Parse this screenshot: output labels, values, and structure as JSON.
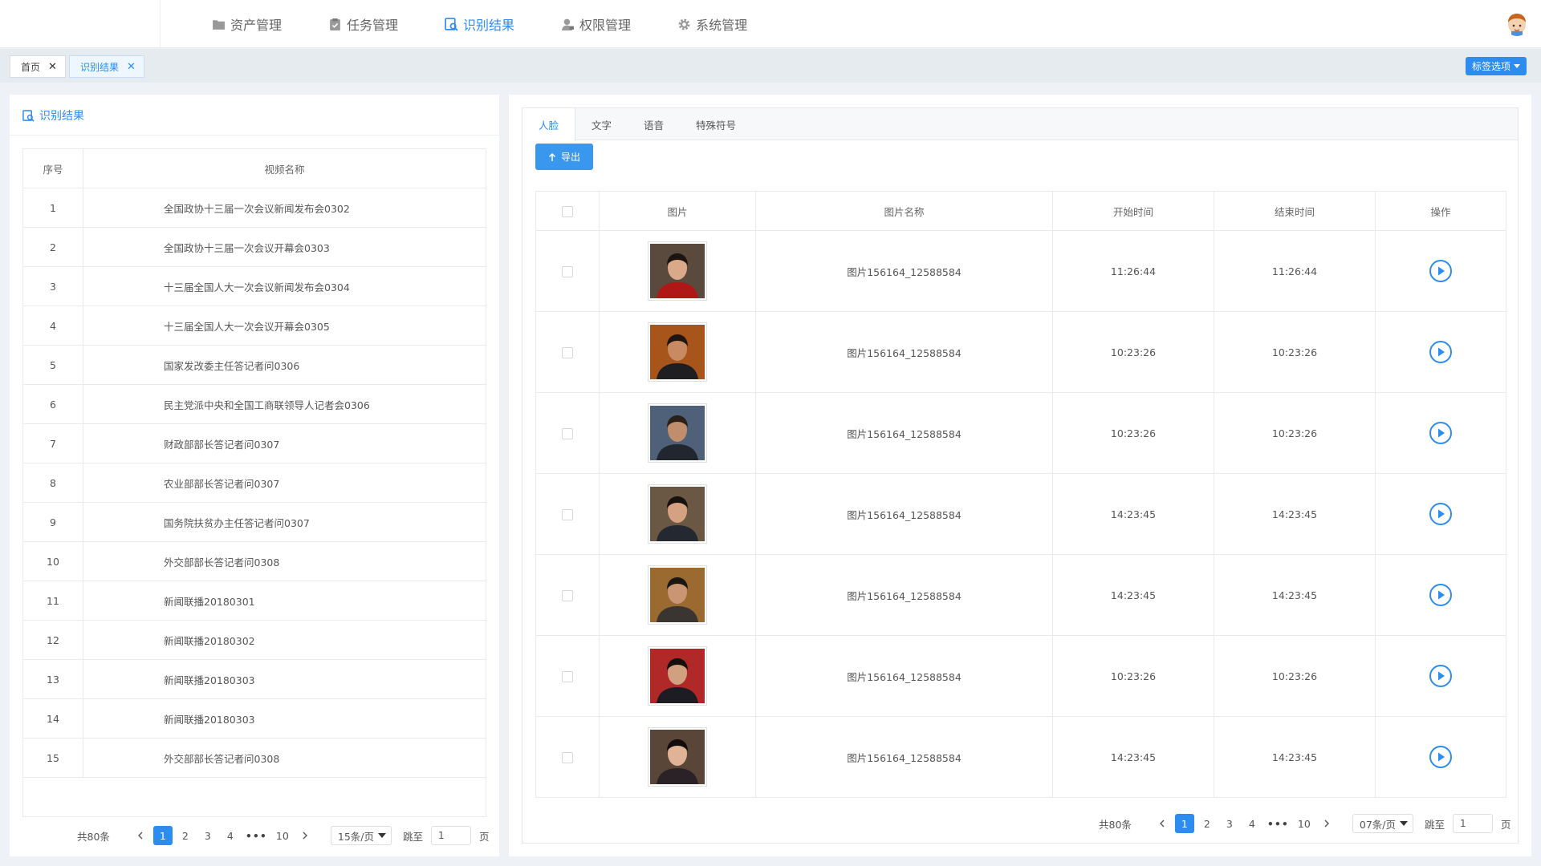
{
  "header": {
    "nav": [
      {
        "label": "资产管理",
        "icon": "folder-icon",
        "active": false
      },
      {
        "label": "任务管理",
        "icon": "clipboard-icon",
        "active": false
      },
      {
        "label": "识别结果",
        "icon": "recognition-icon",
        "active": true
      },
      {
        "label": "权限管理",
        "icon": "user-lock-icon",
        "active": false
      },
      {
        "label": "系统管理",
        "icon": "gear-icon",
        "active": false
      }
    ]
  },
  "tabbar": {
    "tags": [
      {
        "label": "首页",
        "active": false
      },
      {
        "label": "识别结果",
        "active": true
      }
    ],
    "tag_options_label": "标签选项"
  },
  "left_panel": {
    "title": "识别结果",
    "columns": [
      "序号",
      "视频名称"
    ],
    "rows": [
      {
        "no": "1",
        "name": "全国政协十三届一次会议新闻发布会0302"
      },
      {
        "no": "2",
        "name": "全国政协十三届一次会议开幕会0303"
      },
      {
        "no": "3",
        "name": "十三届全国人大一次会议新闻发布会0304"
      },
      {
        "no": "4",
        "name": "十三届全国人大一次会议开幕会0305"
      },
      {
        "no": "5",
        "name": "国家发改委主任答记者问0306"
      },
      {
        "no": "6",
        "name": "民主党派中央和全国工商联领导人记者会0306"
      },
      {
        "no": "7",
        "name": "财政部部长答记者问0307"
      },
      {
        "no": "8",
        "name": "农业部部长答记者问0307"
      },
      {
        "no": "9",
        "name": "国务院扶贫办主任答记者问0307"
      },
      {
        "no": "10",
        "name": "外交部部长答记者问0308"
      },
      {
        "no": "11",
        "name": "新闻联播20180301"
      },
      {
        "no": "12",
        "name": "新闻联播20180302"
      },
      {
        "no": "13",
        "name": "新闻联播20180303"
      },
      {
        "no": "14",
        "name": "新闻联播20180303"
      },
      {
        "no": "15",
        "name": "外交部部长答记者问0308"
      }
    ],
    "pager": {
      "total": "共80条",
      "pages": [
        "1",
        "2",
        "3",
        "4",
        "10"
      ],
      "current": "1",
      "dots": "•••",
      "page_size": "15条/页",
      "jump_label": "跳至",
      "jump_value": "1",
      "page_unit": "页"
    }
  },
  "right_panel": {
    "tabs": [
      {
        "label": "人脸",
        "active": true
      },
      {
        "label": "文字",
        "active": false
      },
      {
        "label": "语音",
        "active": false
      },
      {
        "label": "特殊符号",
        "active": false
      }
    ],
    "export_label": "导出",
    "columns": [
      "图片",
      "图片名称",
      "开始时间",
      "结束时间",
      "操作"
    ],
    "rows": [
      {
        "image_name": "图片156164_12588584",
        "start": "11:26:44",
        "end": "11:26:44",
        "bg": "#5a4a3e",
        "skin": "#d9a98a",
        "hair": "#1c1410",
        "cloth": "#b01818"
      },
      {
        "image_name": "图片156164_12588584",
        "start": "10:23:26",
        "end": "10:23:26",
        "bg": "#a8551c",
        "skin": "#c88a62",
        "hair": "#201510",
        "cloth": "#1f1f22"
      },
      {
        "image_name": "图片156164_12588584",
        "start": "10:23:26",
        "end": "10:23:26",
        "bg": "#4f6178",
        "skin": "#c08e6c",
        "hair": "#2a2018",
        "cloth": "#22262e"
      },
      {
        "image_name": "图片156164_12588584",
        "start": "14:23:45",
        "end": "14:23:45",
        "bg": "#6a5844",
        "skin": "#d4a280",
        "hair": "#17120e",
        "cloth": "#242830"
      },
      {
        "image_name": "图片156164_12588584",
        "start": "14:23:45",
        "end": "14:23:45",
        "bg": "#9a6a30",
        "skin": "#c99572",
        "hair": "#1c1612",
        "cloth": "#3a3530"
      },
      {
        "image_name": "图片156164_12588584",
        "start": "10:23:26",
        "end": "10:23:26",
        "bg": "#b02828",
        "skin": "#d1a07e",
        "hair": "#15100c",
        "cloth": "#1c1c22"
      },
      {
        "image_name": "图片156164_12588584",
        "start": "14:23:45",
        "end": "14:23:45",
        "bg": "#5a4638",
        "skin": "#e0b296",
        "hair": "#120c0a",
        "cloth": "#2a2226"
      }
    ],
    "pager": {
      "total": "共80条",
      "pages": [
        "1",
        "2",
        "3",
        "4",
        "10"
      ],
      "current": "1",
      "dots": "•••",
      "page_size": "07条/页",
      "jump_label": "跳至",
      "jump_value": "1",
      "page_unit": "页"
    }
  },
  "colors": {
    "accent": "#2d8cf0"
  }
}
